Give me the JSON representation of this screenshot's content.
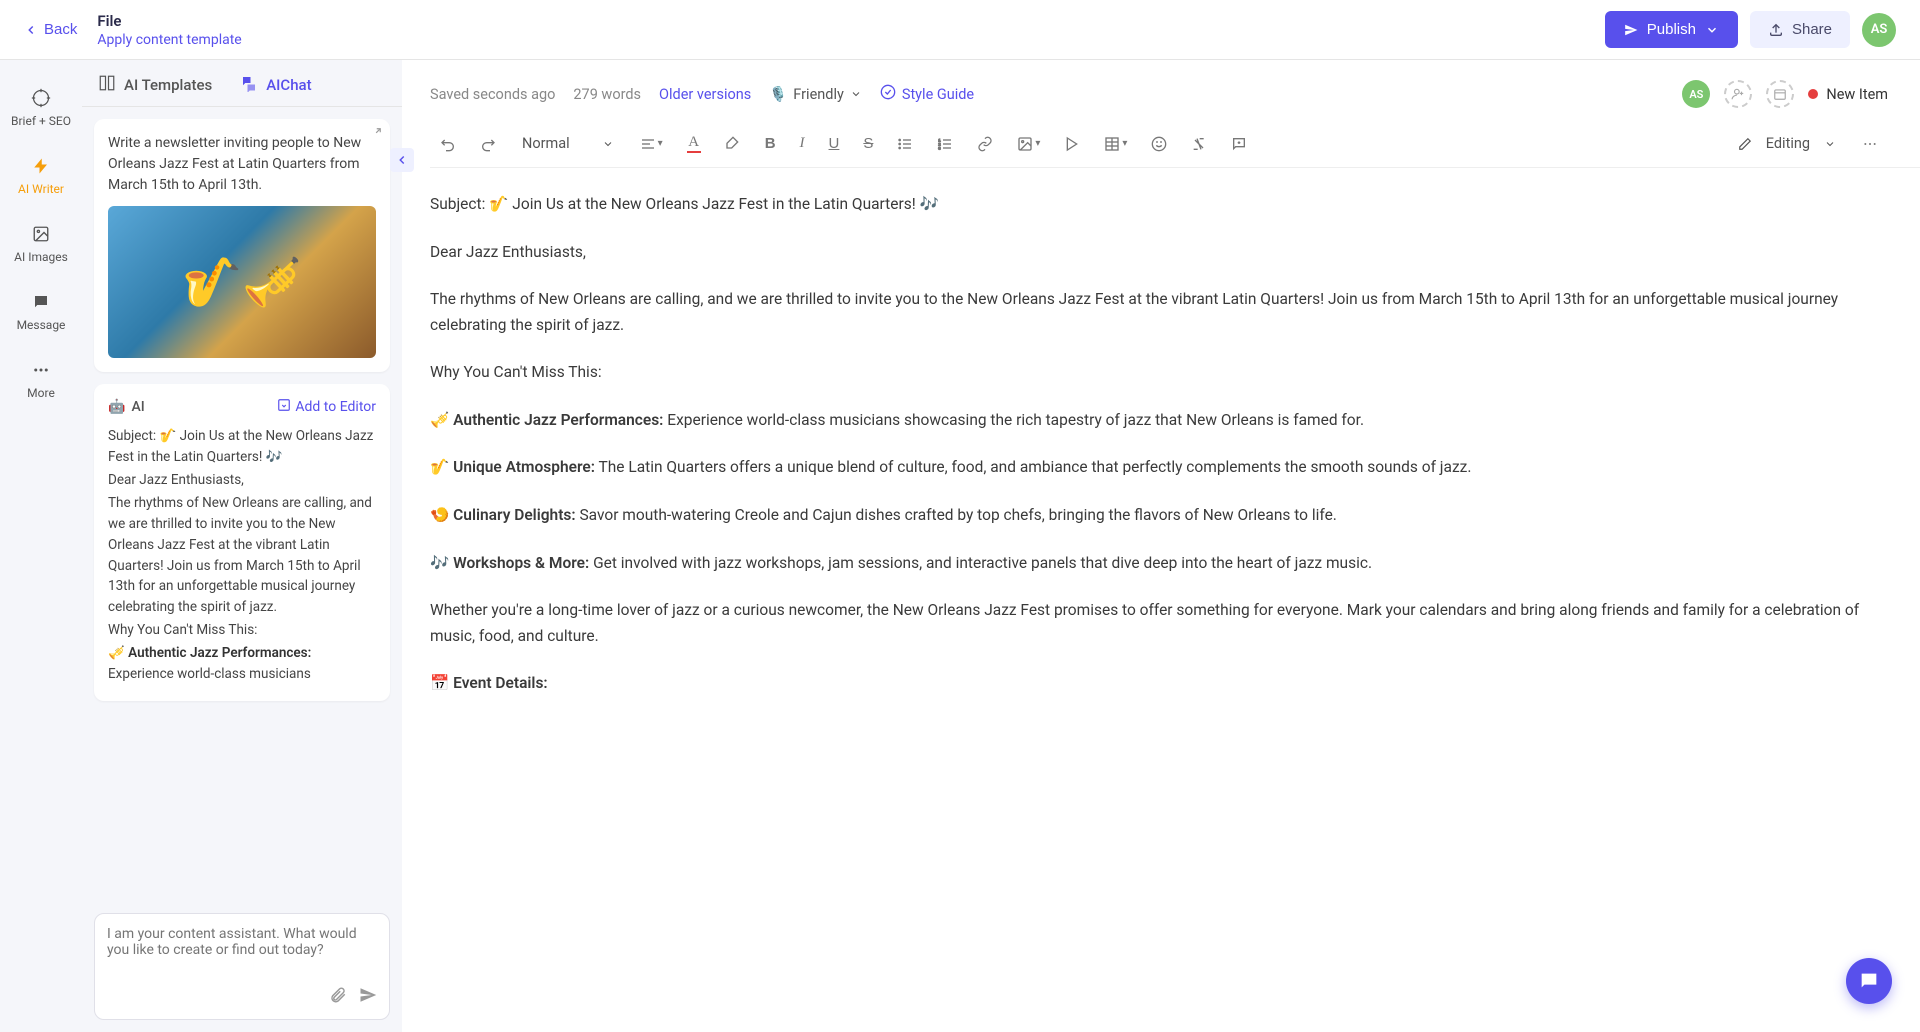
{
  "header": {
    "back": "Back",
    "file_title": "File",
    "file_subtitle": "Apply content template",
    "publish": "Publish",
    "share": "Share",
    "avatar": "AS"
  },
  "rail": {
    "brief": "Brief + SEO",
    "writer": "AI Writer",
    "images": "AI Images",
    "message": "Message",
    "more": "More"
  },
  "chat": {
    "tab_templates": "AI Templates",
    "tab_chat": "AIChat",
    "user_prompt": "Write a newsletter inviting people to New Orleans Jazz Fest at Latin Quarters from March 15th to April 13th.",
    "ai_label": "AI",
    "add_to_editor": "Add to Editor",
    "ai_p1": "Subject: 🎷 Join Us at the New Orleans Jazz Fest in the Latin Quarters! 🎶",
    "ai_p2": "Dear Jazz Enthusiasts,",
    "ai_p3": "The rhythms of New Orleans are calling, and we are thrilled to invite you to the New Orleans Jazz Fest at the vibrant Latin Quarters! Join us from March 15th to April 13th for an unforgettable musical journey celebrating the spirit of jazz.",
    "ai_p4": "Why You Can't Miss This:",
    "ai_perf_emoji": "🎺 ",
    "ai_perf_bold": "Authentic Jazz Performances:",
    "ai_perf_tail": " Experience world-class musicians",
    "input_placeholder": "I am your content assistant. What would you like to create or find out today?"
  },
  "editor": {
    "saved": "Saved seconds ago",
    "words": "279 words",
    "older": "Older versions",
    "friendly": "Friendly",
    "style_guide": "Style Guide",
    "avatar": "AS",
    "new_item": "New Item"
  },
  "toolbar": {
    "normal": "Normal",
    "editing": "Editing"
  },
  "doc": {
    "p_subject": "Subject: 🎷 Join Us at the New Orleans Jazz Fest in the Latin Quarters! 🎶",
    "p_greeting": "Dear Jazz Enthusiasts,",
    "p_intro": "The rhythms of New Orleans are calling, and we are thrilled to invite you to the New Orleans Jazz Fest at the vibrant Latin Quarters! Join us from March 15th to April 13th for an unforgettable musical journey celebrating the spirit of jazz.",
    "p_why": "Why You Can't Miss This:",
    "perf_emoji": "🎺 ",
    "perf_bold": "Authentic Jazz Performances:",
    "perf_text": " Experience world-class musicians showcasing the rich tapestry of jazz that New Orleans is famed for.",
    "atmos_emoji": "🎷 ",
    "atmos_bold": "Unique Atmosphere:",
    "atmos_text": " The Latin Quarters offers a unique blend of culture, food, and ambiance that perfectly complements the smooth sounds of jazz.",
    "cul_emoji": "🍤 ",
    "cul_bold": "Culinary Delights:",
    "cul_text": " Savor mouth-watering Creole and Cajun dishes crafted by top chefs, bringing the flavors of New Orleans to life.",
    "work_emoji": "🎶 ",
    "work_bold": "Workshops & More:",
    "work_text": " Get involved with jazz workshops, jam sessions, and interactive panels that dive deep into the heart of jazz music.",
    "p_closing": "Whether you're a long-time lover of jazz or a curious newcomer, the New Orleans Jazz Fest promises to offer something for everyone. Mark your calendars and bring along friends and family for a celebration of music, food, and culture.",
    "event_emoji": "📅 ",
    "event_bold": "Event Details:"
  }
}
